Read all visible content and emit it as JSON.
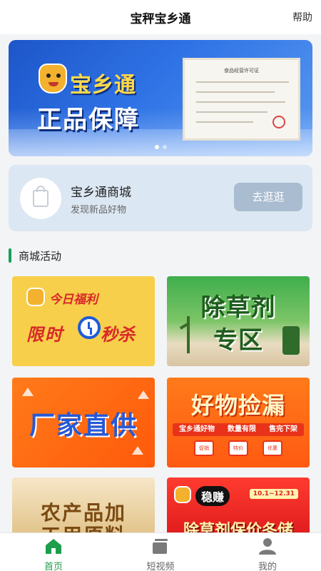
{
  "header": {
    "title": "宝秤宝乡通",
    "help_label": "帮助"
  },
  "banner": {
    "brand": "宝乡通",
    "slogan": "正品保障",
    "certificate_title": "食品经营许可证",
    "page_count": 2,
    "active_page": 1
  },
  "mall": {
    "name": "宝乡通商城",
    "subtitle": "发现新品好物",
    "button_label": "去逛逛"
  },
  "section": {
    "title": "商城活动"
  },
  "activities": [
    {
      "line1": "今日福利",
      "line2a": "限时",
      "line2b": "秒杀"
    },
    {
      "line1": "除草剂",
      "line2": "专区"
    },
    {
      "line1": "厂家直供"
    },
    {
      "line1": "好物捡漏",
      "strip": [
        "宝乡通好物",
        "数量有限",
        "售完下架"
      ],
      "chips": [
        "促销",
        "特价",
        "优惠"
      ]
    },
    {
      "line1": "农产品加",
      "line2": "工用原料"
    },
    {
      "badge": "稳赚",
      "date": "10.1~12.31",
      "line1": "除草剂保价冬储"
    }
  ],
  "tabbar": {
    "tabs": [
      {
        "label": "首页",
        "active": true
      },
      {
        "label": "短视频",
        "active": false
      },
      {
        "label": "我的",
        "active": false
      }
    ]
  },
  "colors": {
    "accent_green": "#1e9e4c",
    "banner_blue": "#2f73e6",
    "mall_card_bg": "#dbe7f2",
    "button_bg": "#aabccf"
  }
}
